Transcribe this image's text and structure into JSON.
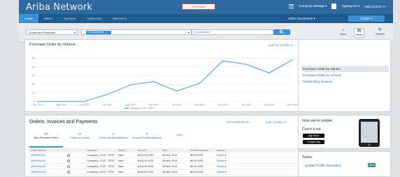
{
  "app": {
    "title": "Ariba Network",
    "test_badge": "Test Mode",
    "company_settings": "Company Settings ▾",
    "user": "Ogeing Clo ▾",
    "help": "Help Center >>"
  },
  "nav": {
    "items": [
      "HOME",
      "INBOX",
      "OUTBOX",
      "CATALOGS",
      "REPORTS"
    ],
    "active_index": 0,
    "other_docs": "Other Documents ▾",
    "create": "Create ▾"
  },
  "search": {
    "doc_type": "Orders and Releases",
    "filter_chip": "PO Comments",
    "placeholder": "Exact Number"
  },
  "toolbar": {
    "items": [
      {
        "label": "Home",
        "icon": "home-icon"
      },
      {
        "label": "Trends",
        "icon": "trends-icon"
      },
      {
        "label": "Refresh",
        "icon": "refresh-icon"
      }
    ],
    "selected_index": 1
  },
  "chart_data": {
    "type": "line",
    "title": "Purchase Order by Volume",
    "range_label": "Last 12 months ▾",
    "categories": [
      "Apr 2015",
      "May 2015",
      "Jun 2015",
      "Jul 2015",
      "Aug 2015",
      "Sep 2015",
      "Oct 2015",
      "Nov 2015",
      "Dec 2015",
      "Jan 2016",
      "Feb 2016",
      "Mar 2016"
    ],
    "series": [
      {
        "name": "Company: 1710 - TEST",
        "values": [
          0,
          0,
          0,
          8,
          19,
          23,
          12,
          21,
          47,
          43,
          33,
          48
        ],
        "color": "#3d8fd6"
      }
    ],
    "yticks": [
      0,
      10,
      20,
      30,
      40,
      50
    ],
    "ylim": [
      0,
      55
    ],
    "legend": "bottom",
    "grid": true
  },
  "side_links": {
    "items": [
      "Purchase Order by Volume",
      "Purchase Order by Amount",
      "Outstanding Invoices"
    ],
    "active_index": 0
  },
  "orders": {
    "title": "Orders, Invoices and Payments",
    "company_filter": "All Customers ▾",
    "range": "Last 14 days ▾",
    "tiles": [
      {
        "count": "17",
        "label": "New Purchase Orders"
      },
      {
        "count": "17",
        "label": "Orders to Confirm"
      },
      {
        "count": "0",
        "label": "Orders that Need Attention"
      },
      {
        "count": "0",
        "label": "Invoices Pending Approval"
      },
      {
        "count": "",
        "label": "More..."
      }
    ],
    "active_tile": 0,
    "columns": [
      "Order Number",
      "",
      "Customer",
      "Status",
      "Amount",
      "Date ↓",
      "Amount Invoiced",
      "Actions"
    ],
    "rows": [
      {
        "order": "4500000132",
        "customer": "Company: 1710 - TEST",
        "status": "New",
        "amount": "$220.00 USD",
        "date": "28 Mar 2016",
        "invoiced": "$0.00 USD",
        "action": "Select ▾"
      },
      {
        "order": "4500000130",
        "customer": "Company: 1710 - TEST",
        "status": "New",
        "amount": "$110.00 USD",
        "date": "28 Mar 2016",
        "invoiced": "$0.00 USD",
        "action": "Select ▾"
      },
      {
        "order": "4500000128",
        "customer": "Company: 1710 - TEST",
        "status": "New",
        "amount": "$110.00 USD",
        "date": "28 Mar 2016",
        "invoiced": "$0.00 USD",
        "action": "Select ▾"
      },
      {
        "order": "4500000126",
        "customer": "Company: 1710 - TEST",
        "status": "New",
        "amount": "$110.00 USD",
        "date": "28 Mar 2016",
        "invoiced": "$0.00 USD",
        "action": "Select ▾"
      }
    ]
  },
  "mobile": {
    "title": "Now we're mobile.",
    "subtitle": "Check it out",
    "stores": [
      "App Store",
      "Google play"
    ]
  },
  "tasks": {
    "title": "Tasks",
    "item": "Update Profile Information",
    "badge": "NEW"
  }
}
